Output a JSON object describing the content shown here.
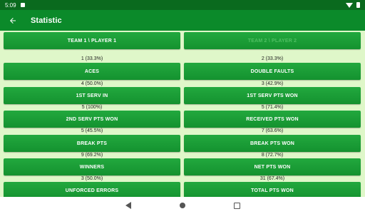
{
  "status": {
    "time": "5:09"
  },
  "appbar": {
    "title": "Statistic"
  },
  "header": {
    "left": "TEAM 1 \\ PLAYER 1",
    "right": "TEAM 2 \\ PLAYER 2"
  },
  "rows": [
    {
      "left_value": "1 (33.3%)",
      "left_label": "ACES",
      "right_value": "2 (33.3%)",
      "right_label": "DOUBLE FAULTS"
    },
    {
      "left_value": "4 (50.0%)",
      "left_label": "1ST SERV IN",
      "right_value": "3 (42.9%)",
      "right_label": "1ST SERV PTS WON"
    },
    {
      "left_value": "5 (100%)",
      "left_label": "2ND SERV PTS WON",
      "right_value": "5 (71.4%)",
      "right_label": "RECEIVED PTS WON"
    },
    {
      "left_value": "5 (45.5%)",
      "left_label": "BREAK PTS",
      "right_value": "7 (63.6%)",
      "right_label": "BREAK PTS WON"
    },
    {
      "left_value": "9 (69.2%)",
      "left_label": "WINNERS",
      "right_value": "8 (72.7%)",
      "right_label": "NET PTS WON"
    },
    {
      "left_value": "3 (50.0%)",
      "left_label": "UNFORCED ERRORS",
      "right_value": "31 (67.4%)",
      "right_label": "TOTAL PTS WON"
    }
  ],
  "colors": {
    "primary": "#0b8a2a",
    "status_bar": "#0a6a1e",
    "button": "#1aa036",
    "background": "#dff7c9"
  }
}
